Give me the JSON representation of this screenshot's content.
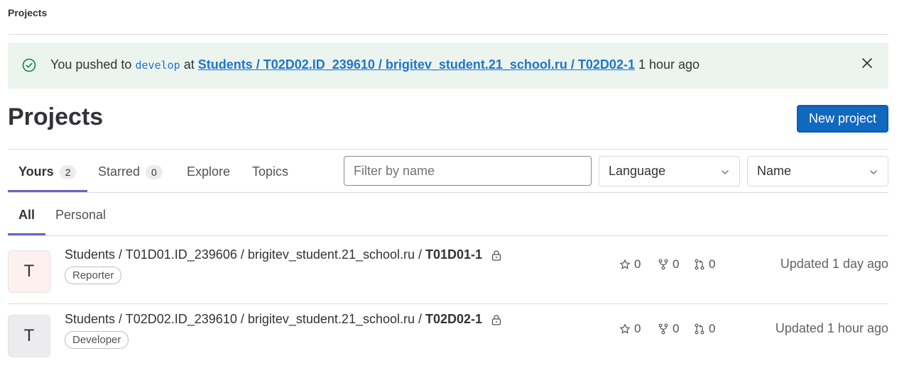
{
  "breadcrumb": "Projects",
  "alert": {
    "prefix": "You pushed to",
    "branch": "develop",
    "middle": "at",
    "repo_link": "Students / T02D02.ID_239610 / brigitev_student.21_school.ru / T02D02-1",
    "time": "1 hour ago"
  },
  "page_title": "Projects",
  "new_project_label": "New project",
  "tabs": [
    {
      "label": "Yours",
      "count": "2"
    },
    {
      "label": "Starred",
      "count": "0"
    },
    {
      "label": "Explore"
    },
    {
      "label": "Topics"
    }
  ],
  "filter": {
    "placeholder": "Filter by name"
  },
  "language_dropdown": "Language",
  "sort_dropdown": "Name",
  "subtabs": [
    {
      "label": "All"
    },
    {
      "label": "Personal"
    }
  ],
  "projects": [
    {
      "avatar": "T",
      "avatar_color": "#fcf1ef",
      "namespace": "Students / T01D01.ID_239606 / brigitev_student.21_school.ru /",
      "name": "T01D01-1",
      "role": "Reporter",
      "stars": "0",
      "forks": "0",
      "merge_requests": "0",
      "updated": "Updated 1 day ago"
    },
    {
      "avatar": "T",
      "avatar_color": "#ececef",
      "namespace": "Students / T02D02.ID_239610 / brigitev_student.21_school.ru /",
      "name": "T02D02-1",
      "role": "Developer",
      "stars": "0",
      "forks": "0",
      "merge_requests": "0",
      "updated": "Updated 1 hour ago"
    }
  ]
}
